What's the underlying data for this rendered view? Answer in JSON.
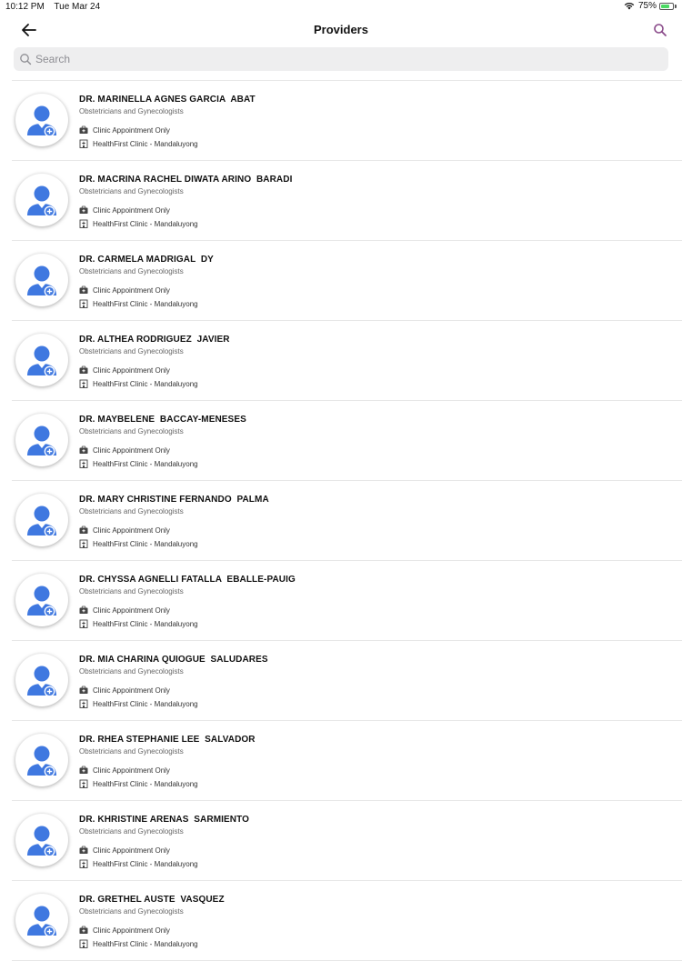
{
  "status_bar": {
    "time": "10:12 PM",
    "date": "Tue Mar 24",
    "battery_percent": "75%",
    "battery_level": 0.75
  },
  "header": {
    "title": "Providers",
    "back_icon": "arrow-left-icon",
    "search_icon": "search-icon"
  },
  "search": {
    "placeholder": "Search",
    "value": ""
  },
  "colors": {
    "accent": "#8a4a8a",
    "avatar_blue": "#3f78e0",
    "divider": "#e7e7e7"
  },
  "providers": [
    {
      "name": "DR. MARINELLA AGNES GARCIA  ABAT",
      "specialty": "Obstetricians and Gynecologists",
      "appointment": "Clinic Appointment Only",
      "clinic": "HealthFirst Clinic - Mandaluyong"
    },
    {
      "name": "DR. MACRINA RACHEL DIWATA ARINO  BARADI",
      "specialty": "Obstetricians and Gynecologists",
      "appointment": "Clinic Appointment Only",
      "clinic": "HealthFirst Clinic - Mandaluyong"
    },
    {
      "name": "DR. CARMELA MADRIGAL  DY",
      "specialty": "Obstetricians and Gynecologists",
      "appointment": "Clinic Appointment Only",
      "clinic": "HealthFirst Clinic - Mandaluyong"
    },
    {
      "name": "DR. ALTHEA RODRIGUEZ  JAVIER",
      "specialty": "Obstetricians and Gynecologists",
      "appointment": "Clinic Appointment Only",
      "clinic": "HealthFirst Clinic - Mandaluyong"
    },
    {
      "name": "DR. MAYBELENE  BACCAY-MENESES",
      "specialty": "Obstetricians and Gynecologists",
      "appointment": "Clinic Appointment Only",
      "clinic": "HealthFirst Clinic - Mandaluyong"
    },
    {
      "name": "DR. MARY CHRISTINE FERNANDO  PALMA",
      "specialty": "Obstetricians and Gynecologists",
      "appointment": "Clinic Appointment Only",
      "clinic": "HealthFirst Clinic - Mandaluyong"
    },
    {
      "name": "DR. CHYSSA AGNELLI FATALLA  EBALLE-PAUIG",
      "specialty": "Obstetricians and Gynecologists",
      "appointment": "Clinic Appointment Only",
      "clinic": "HealthFirst Clinic - Mandaluyong"
    },
    {
      "name": "DR. MIA CHARINA QUIOGUE  SALUDARES",
      "specialty": "Obstetricians and Gynecologists",
      "appointment": "Clinic Appointment Only",
      "clinic": "HealthFirst Clinic - Mandaluyong"
    },
    {
      "name": "DR. RHEA STEPHANIE LEE  SALVADOR",
      "specialty": "Obstetricians and Gynecologists",
      "appointment": "Clinic Appointment Only",
      "clinic": "HealthFirst Clinic - Mandaluyong"
    },
    {
      "name": "DR. KHRISTINE ARENAS  SARMIENTO",
      "specialty": "Obstetricians and Gynecologists",
      "appointment": "Clinic Appointment Only",
      "clinic": "HealthFirst Clinic - Mandaluyong"
    },
    {
      "name": "DR. GRETHEL AUSTE  VASQUEZ",
      "specialty": "Obstetricians and Gynecologists",
      "appointment": "Clinic Appointment Only",
      "clinic": "HealthFirst Clinic - Mandaluyong"
    }
  ]
}
